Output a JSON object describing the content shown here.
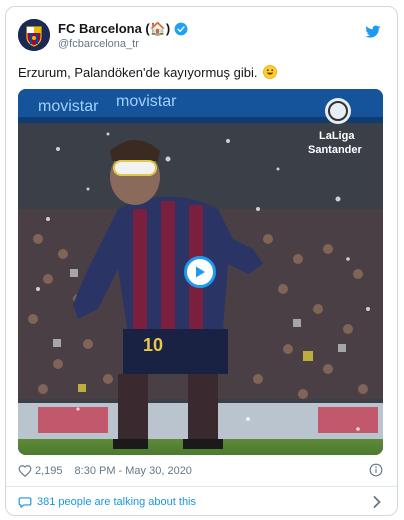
{
  "tweet": {
    "display_name": "FC Barcelona (🏠)",
    "handle": "@fcbarcelona_tr",
    "text": "Erzurum, Palandöken'de kayıyormuş gibi.",
    "emoji_icon": "grinning-face-icon",
    "likes": "2,195",
    "timestamp": "8:30 PM - May 30, 2020",
    "talking": "381 people are talking about this"
  },
  "media": {
    "banner_left": "movistar",
    "banner_mid": "movistar",
    "laliga_line1": "LaLiga",
    "laliga_line2": "Santander",
    "jersey_number": "10"
  },
  "colors": {
    "brand_blue": "#1d9bf0",
    "verified_blue": "#1da1f2",
    "text_gray": "#657786"
  }
}
